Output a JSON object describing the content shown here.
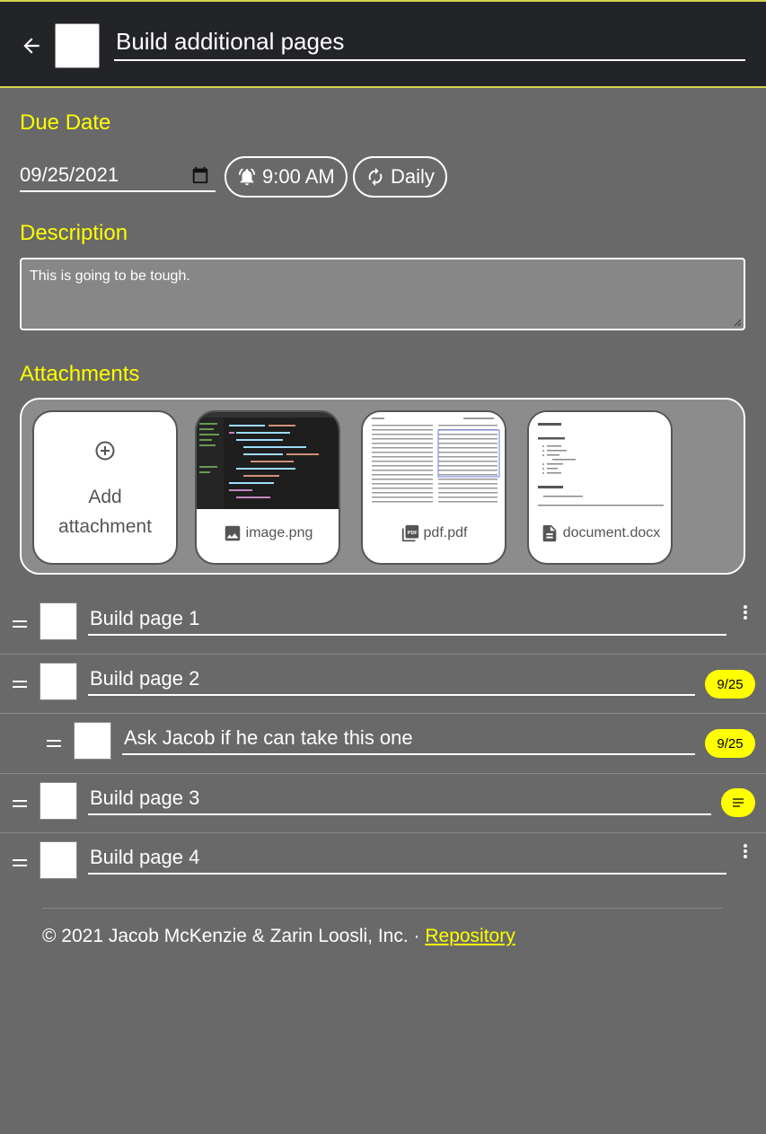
{
  "header": {
    "title_value": "Build additional pages"
  },
  "due_date": {
    "label": "Due Date",
    "date": "09/25/2021",
    "time": "9:00 AM",
    "repeat": "Daily"
  },
  "description": {
    "label": "Description",
    "text": "This is going to be tough."
  },
  "attachments": {
    "label": "Attachments",
    "add_label_line1": "Add",
    "add_label_line2": "attachment",
    "items": [
      {
        "name": "image.png",
        "icon": "image-icon"
      },
      {
        "name": "pdf.pdf",
        "icon": "pdf-icon"
      },
      {
        "name": "document.docx",
        "icon": "document-icon"
      }
    ]
  },
  "subtasks": [
    {
      "title": "Build page 1",
      "badge": ""
    },
    {
      "title": "Build page 2",
      "badge": "9/25"
    },
    {
      "title": "Ask Jacob if he can take this one",
      "badge": "9/25"
    },
    {
      "title": "Build page 3",
      "badge": "note-icon"
    },
    {
      "title": "Build page 4",
      "badge": ""
    }
  ],
  "footer": {
    "copyright": "© 2021 Jacob McKenzie & Zarin Loosli, Inc. · ",
    "link": "Repository"
  },
  "colors": {
    "accent": "#ffff00",
    "header_bg": "#222428",
    "page_bg": "#696969"
  }
}
